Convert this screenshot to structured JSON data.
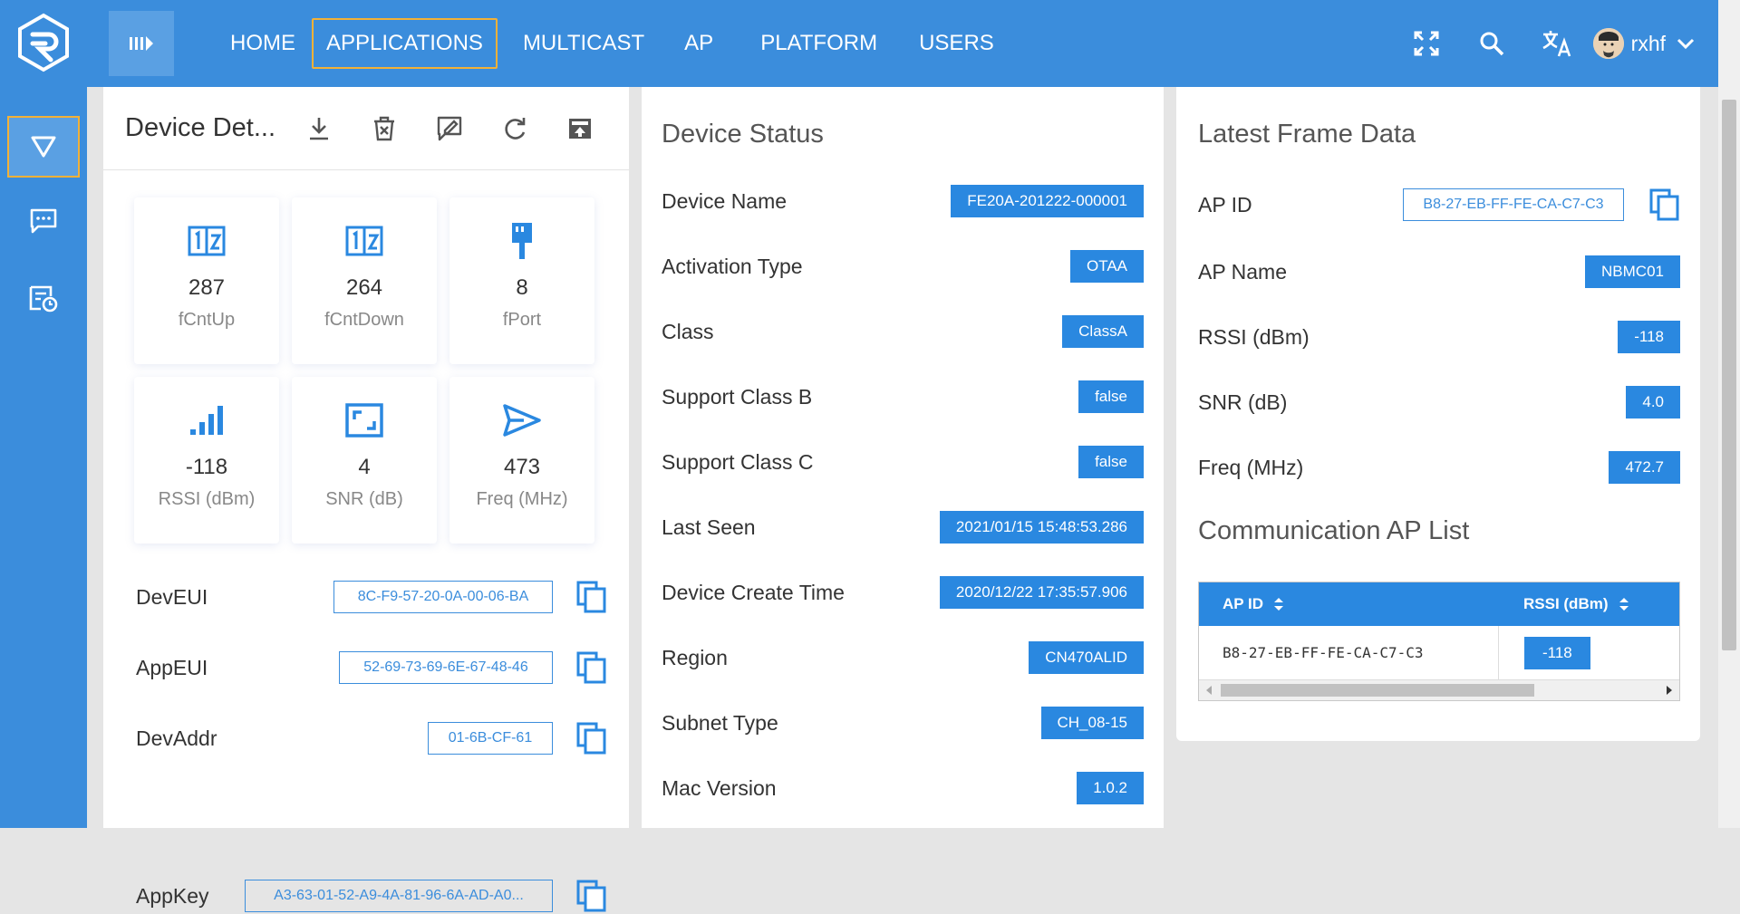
{
  "nav": {
    "items": [
      "HOME",
      "APPLICATIONS",
      "MULTICAST",
      "AP",
      "PLATFORM",
      "USERS"
    ],
    "active_index": 1,
    "username": "rxhf"
  },
  "colors": {
    "primary": "#3b8ddc",
    "badge": "#2a88e0",
    "active_outline": "#f2b138"
  },
  "device_details": {
    "title": "Device Det...",
    "header_icons": [
      "download-icon",
      "delete-icon",
      "edit-icon",
      "refresh-icon",
      "upload-icon"
    ],
    "stats": [
      {
        "icon": "counter-icon",
        "value": "287",
        "label": "fCntUp"
      },
      {
        "icon": "counter-icon",
        "value": "264",
        "label": "fCntDown"
      },
      {
        "icon": "port-icon",
        "value": "8",
        "label": "fPort"
      },
      {
        "icon": "signal-icon",
        "value": "-118",
        "label": "RSSI (dBm)"
      },
      {
        "icon": "snr-icon",
        "value": "4",
        "label": "SNR (dB)"
      },
      {
        "icon": "send-icon",
        "value": "473",
        "label": "Freq (MHz)"
      }
    ],
    "keys": [
      {
        "label": "DevEUI",
        "value": "8C-F9-57-20-0A-00-06-BA"
      },
      {
        "label": "AppEUI",
        "value": "52-69-73-69-6E-67-48-46"
      },
      {
        "label": "DevAddr",
        "value": "01-6B-CF-61"
      },
      {
        "label": "AppKey",
        "value": "A3-63-01-52-A9-4A-81-96-6A-AD-A0..."
      }
    ]
  },
  "device_status": {
    "title": "Device Status",
    "rows": [
      {
        "label": "Device Name",
        "value": "FE20A-201222-000001"
      },
      {
        "label": "Activation Type",
        "value": "OTAA"
      },
      {
        "label": "Class",
        "value": "ClassA"
      },
      {
        "label": "Support Class B",
        "value": "false"
      },
      {
        "label": "Support Class C",
        "value": "false"
      },
      {
        "label": "Last Seen",
        "value": "2021/01/15 15:48:53.286"
      },
      {
        "label": "Device Create Time",
        "value": "2020/12/22 17:35:57.906"
      },
      {
        "label": "Region",
        "value": "CN470ALID"
      },
      {
        "label": "Subnet Type",
        "value": "CH_08-15"
      },
      {
        "label": "Mac Version",
        "value": "1.0.2"
      }
    ]
  },
  "latest_frame": {
    "title": "Latest Frame Data",
    "ap_id_label": "AP ID",
    "ap_id_value": "B8-27-EB-FF-FE-CA-C7-C3",
    "rows": [
      {
        "label": "AP Name",
        "value": "NBMC01"
      },
      {
        "label": "RSSI (dBm)",
        "value": "-118"
      },
      {
        "label": "SNR (dB)",
        "value": "4.0"
      },
      {
        "label": "Freq (MHz)",
        "value": "472.7"
      }
    ]
  },
  "ap_list": {
    "title": "Communication AP List",
    "columns": [
      "AP ID",
      "RSSI (dBm)"
    ],
    "rows": [
      {
        "ap_id": "B8-27-EB-FF-FE-CA-C7-C3",
        "rssi": "-118"
      }
    ]
  }
}
